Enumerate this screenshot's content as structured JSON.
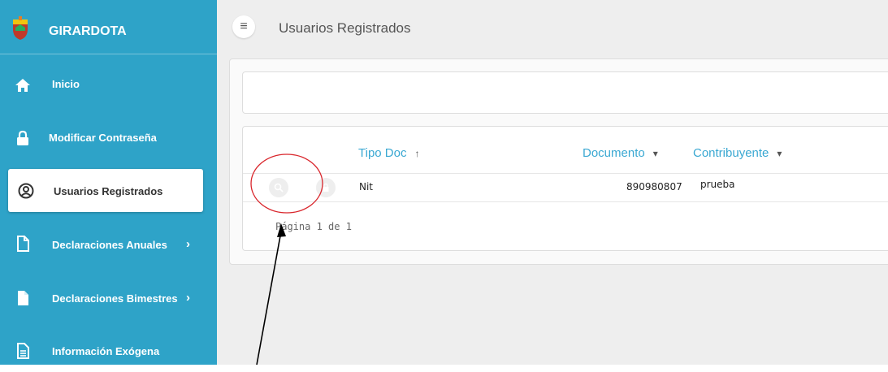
{
  "sidebar": {
    "brand": "GIRARDOTA",
    "items": [
      {
        "label": "Inicio",
        "icon": "home-icon"
      },
      {
        "label": "Modificar Contraseña",
        "icon": "lock-icon"
      },
      {
        "label": "Usuarios Registrados",
        "icon": "user-circle-icon",
        "active": true
      },
      {
        "label": "Declaraciones Anuales",
        "icon": "document-icon",
        "chevron": "›"
      },
      {
        "label": "Declaraciones Bimestres",
        "icon": "document-filled-icon",
        "chevron": "›"
      },
      {
        "label": "Información Exógena",
        "icon": "document-lines-icon"
      }
    ]
  },
  "header": {
    "menu_glyph": "≡",
    "title": "Usuarios Registrados"
  },
  "grid": {
    "columns": [
      {
        "label": "Tipo Doc",
        "sort": "↑"
      },
      {
        "label": "Documento",
        "sort": "▾"
      },
      {
        "label": "Contribuyente",
        "sort": "▾"
      }
    ],
    "rows": [
      {
        "tipo_doc": "Nit",
        "documento": "890980807",
        "contribuyente": "prueba"
      }
    ],
    "pager": "Página 1 de 1"
  },
  "colors": {
    "sidebar": "#2ea3c8",
    "accent_header": "#3aa8d2",
    "annotation_circle": "#d9262c"
  }
}
